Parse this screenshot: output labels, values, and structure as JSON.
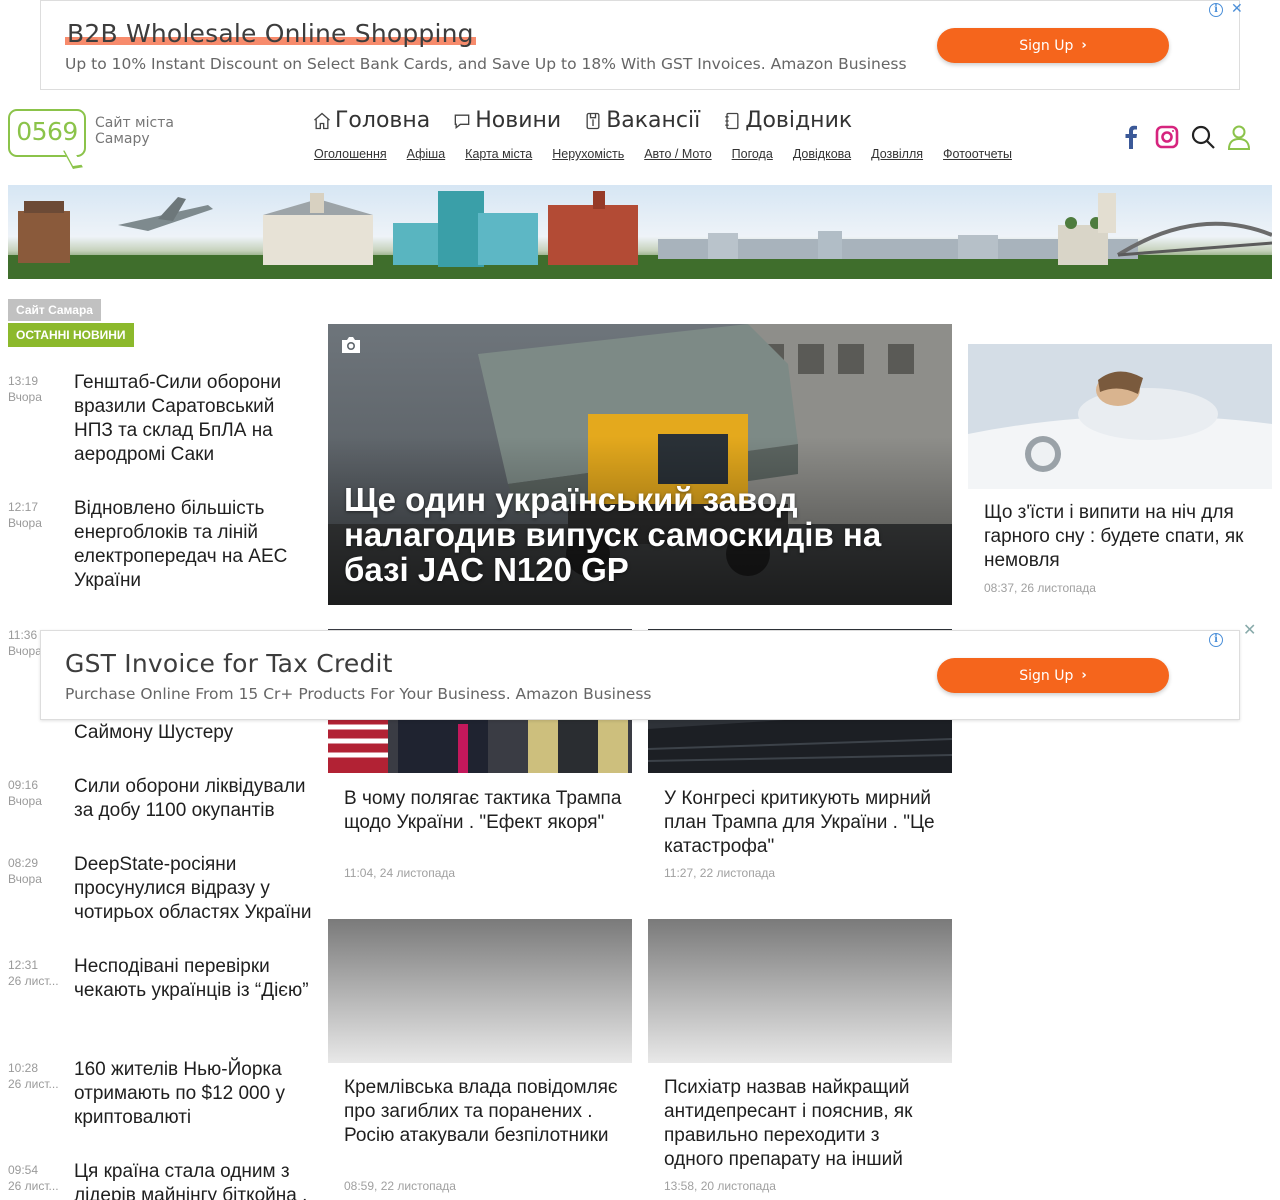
{
  "ads": {
    "top": {
      "title": "B2B Wholesale Online Shopping",
      "description": "Up to 10% Instant Discount on Select Bank Cards, and Save Up to 18% With GST Invoices. Amazon Business",
      "button": "Sign Up"
    },
    "middle": {
      "title": "GST Invoice for Tax Credit",
      "description": "Purchase Online From 15 Cr+ Products For Your Business. Amazon Business",
      "button": "Sign Up"
    },
    "info_glyph": "i",
    "close_glyph": "✕"
  },
  "header": {
    "logo_number": "0569",
    "logo_line1": "Сайт міста",
    "logo_line2": "Самару",
    "main_nav": [
      {
        "label": "Головна",
        "icon": "home-icon"
      },
      {
        "label": "Новини",
        "icon": "chat-bubble-icon"
      },
      {
        "label": "Вакансії",
        "icon": "briefcase-icon"
      },
      {
        "label": "Довідник",
        "icon": "notebook-icon"
      }
    ],
    "sub_nav": [
      "Оголошення",
      "Афіша",
      "Карта міста",
      "Нерухомість",
      "Авто / Мото",
      "Погода",
      "Довідкова",
      "Дозвілля",
      "Фотоотчеты"
    ],
    "icons": [
      "facebook-icon",
      "instagram-icon",
      "search-icon",
      "user-icon"
    ],
    "colors": {
      "brand_green": "#8bc34a",
      "facebook": "#3b5998",
      "instagram": "#d6247e"
    }
  },
  "sidebar": {
    "site_tag": "Сайт Самара",
    "section_tag": "ОСТАННІ НОВИНИ",
    "news": [
      {
        "time": "13:19",
        "day": "Вчора",
        "title": "Генштаб-Сили оборони вразили Саратовський НПЗ та склад БпЛА на аеродромі Саки"
      },
      {
        "time": "12:17",
        "day": "Вчора",
        "title": "Відновлено більшість енергоблоків та ліній електропередач на АЕС України"
      },
      {
        "time": "11:36",
        "day": "Вчора",
        "title": "Саймону Шустеру"
      },
      {
        "time": "09:16",
        "day": "Вчора",
        "title": "Сили оборони ліквідували за добу 1100 окупантів"
      },
      {
        "time": "08:29",
        "day": "Вчора",
        "title": "DeepState-росіяни просунулися відразу у чотирьох областях України"
      },
      {
        "time": "12:31",
        "day": "26 лист...",
        "title": "Несподівані перевірки чекають українців із “Дією”"
      },
      {
        "time": "10:28",
        "day": "26 лист...",
        "title": "160 жителів Нью-Йорка отримають по $12 000 у криптовалюті"
      },
      {
        "time": "09:54",
        "day": "26 лист...",
        "title": "Ця країна стала одним з лідерів майнінгу біткойна ."
      }
    ]
  },
  "hero": {
    "title": "Ще один український завод налагодив випуск самоскидів на базі JAC N120 GP"
  },
  "cards": [
    {
      "title": "В чому полягає тактика Трампа щодо України . \"Ефект якоря\"",
      "date": "11:04, 24 листопада"
    },
    {
      "title": "У Конгресі критикують мирний план Трампа для України . \"Це катастрофа\"",
      "date": "11:27, 22 листопада"
    },
    {
      "title": "Кремлівська влада повідомляє про загиблих та поранених . Росію атакували безпілотники",
      "date": "08:59, 22 листопада"
    },
    {
      "title": "Психіатр назвав найкращий антидепресант і пояснив, як правильно переходити з одного препарату на інший",
      "date": "13:58, 20 листопада"
    }
  ],
  "side": {
    "title": "Що з'їсти і випити на ніч для гарного сну : будете спати, як немовля",
    "date": "08:37, 26 листопада"
  }
}
